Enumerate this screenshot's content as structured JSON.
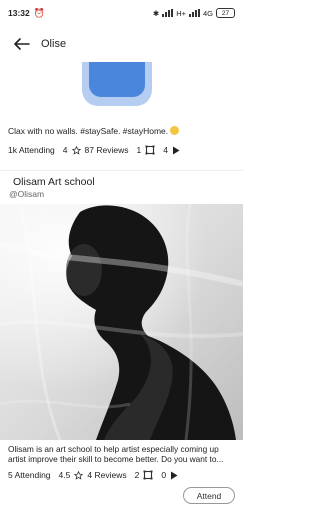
{
  "status_bar": {
    "time": "13:32",
    "network": "H+",
    "network2": "4G",
    "battery": "27"
  },
  "app_bar": {
    "title": "Olise"
  },
  "post1": {
    "caption": "Clax with no walls. #staySafe. #stayHome.",
    "attending": "1k Attending",
    "rating": "4",
    "reviews": "87 Reviews",
    "photos": "1",
    "videos": "4"
  },
  "post2": {
    "title": "Olisam Art school",
    "handle": "@Olisam",
    "description_line1": "Olisam is an art school to help artist especially coming up",
    "description_line2": "artist improve their skill to become better. Do you want to...",
    "attending": "5 Attending",
    "rating": "4.5",
    "reviews": "4 Reviews",
    "photos": "2",
    "videos": "0",
    "attend_label": "Attend"
  },
  "colors": {
    "accent_blue": "#4a86dc",
    "accent_blue_light": "#b6cdf2",
    "emoji_yellow": "#f4c542"
  },
  "icons": {
    "back": "arrow-left-icon",
    "star": "star-outline-icon",
    "photo": "photo-frame-icon",
    "video": "play-icon"
  }
}
